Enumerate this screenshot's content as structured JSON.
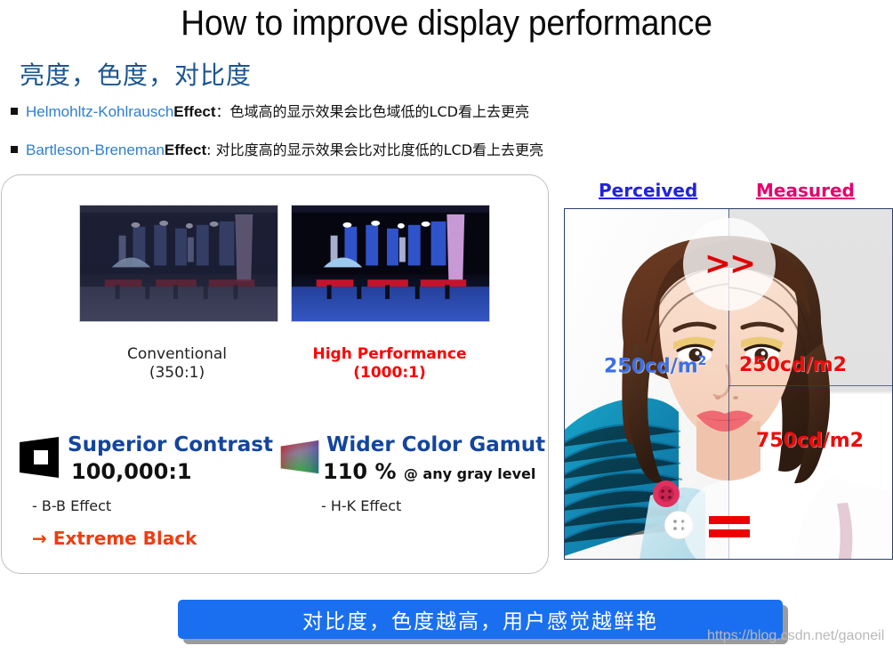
{
  "slide": {
    "title": "How to improve display performance",
    "subtitle": "亮度，色度，对比度",
    "bullets": [
      {
        "name": "Helmohltz-Kohlrausch",
        "effect": "Effect",
        "sep": "：",
        "text": "色域高的显示效果会比色域低的LCD看上去更亮"
      },
      {
        "name": "Bartleson-Breneman",
        "effect": "Effect",
        "sep": ": ",
        "text": "对比度高的显示效果会比对比度低的LCD看上去更亮"
      }
    ]
  },
  "left_panel": {
    "photos": [
      {
        "caption_line1": "Conventional",
        "caption_line2": "(350:1)",
        "color": "#222222"
      },
      {
        "caption_line1": "High Performance",
        "caption_line2": "(1000:1)",
        "color": "#ff0000"
      }
    ],
    "features": [
      {
        "icon": "contrast-screen-icon",
        "title": "Superior Contrast",
        "value": "100,000:1",
        "value_suffix": "",
        "sub": "- B-B Effect",
        "arrow": "→ Extreme Black"
      },
      {
        "icon": "color-gamut-screen-icon",
        "title": "Wider Color Gamut",
        "value": "110 %",
        "value_suffix": "@ any gray level",
        "sub": "- H-K Effect",
        "arrow": ""
      }
    ]
  },
  "right_panel": {
    "heading_perceived": "Perceived",
    "heading_measured": "Measured",
    "heading_perceived_color": "#2222dd",
    "heading_measured_color": "#e6006e",
    "luminance_perceived": "250cd/m",
    "luminance_perceived_sup": "2",
    "luminance_measured_top": "250cd/m2",
    "luminance_measured_bottom": "750cd/m2",
    "symbol_greater": ">>",
    "symbol_equal": "equals-icon"
  },
  "banner": {
    "text": "对比度，色度越高，用户感觉越鲜艳",
    "color": "#1a6ff0"
  },
  "watermark": "https://blog.csdn.net/gaoneil"
}
